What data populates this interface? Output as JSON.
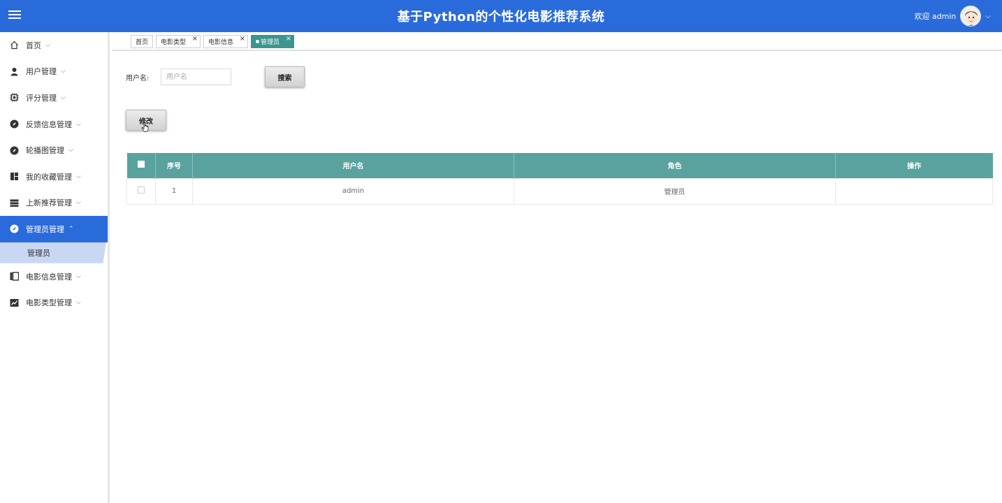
{
  "header": {
    "title": "基于Python的个性化电影推荐系统",
    "welcome": "欢迎 admin",
    "menu_icon": "hamburger-icon",
    "avatar_icon": "avatar-cartoon"
  },
  "sidebar": {
    "items": [
      {
        "label": "首页",
        "icon": "home-icon"
      },
      {
        "label": "用户管理",
        "icon": "person-icon"
      },
      {
        "label": "评分管理",
        "icon": "chip-icon"
      },
      {
        "label": "反馈信息管理",
        "icon": "compass-icon"
      },
      {
        "label": "轮播图管理",
        "icon": "compass-icon"
      },
      {
        "label": "我的收藏管理",
        "icon": "dashboard-icon"
      },
      {
        "label": "上新推荐管理",
        "icon": "storage-icon"
      },
      {
        "label": "管理员管理",
        "icon": "compass-icon",
        "active": true
      },
      {
        "label": "电影信息管理",
        "icon": "book-icon"
      },
      {
        "label": "电影类型管理",
        "icon": "chart-icon"
      }
    ],
    "sub_item": "管理员"
  },
  "tabs": [
    {
      "label": "首页",
      "closable": false
    },
    {
      "label": "电影类型",
      "closable": true
    },
    {
      "label": "电影信息",
      "closable": true
    },
    {
      "label": "管理员",
      "closable": true,
      "active": true
    }
  ],
  "tab_close": "×",
  "search": {
    "label": "用户名:",
    "placeholder": "用户名",
    "value": "",
    "button": "搜索"
  },
  "toolbar": {
    "edit_button": "修改"
  },
  "table": {
    "headers": [
      "序号",
      "用户名",
      "角色",
      "操作"
    ],
    "rows": [
      {
        "index": "1",
        "username": "admin",
        "role": "管理员",
        "actions": ""
      }
    ]
  },
  "colors": {
    "header_bg": "#2a6bdc",
    "table_header_bg": "#5aa29d",
    "active_tab_bg": "#3a968f",
    "sub_item_bg": "#c8d8f4"
  }
}
